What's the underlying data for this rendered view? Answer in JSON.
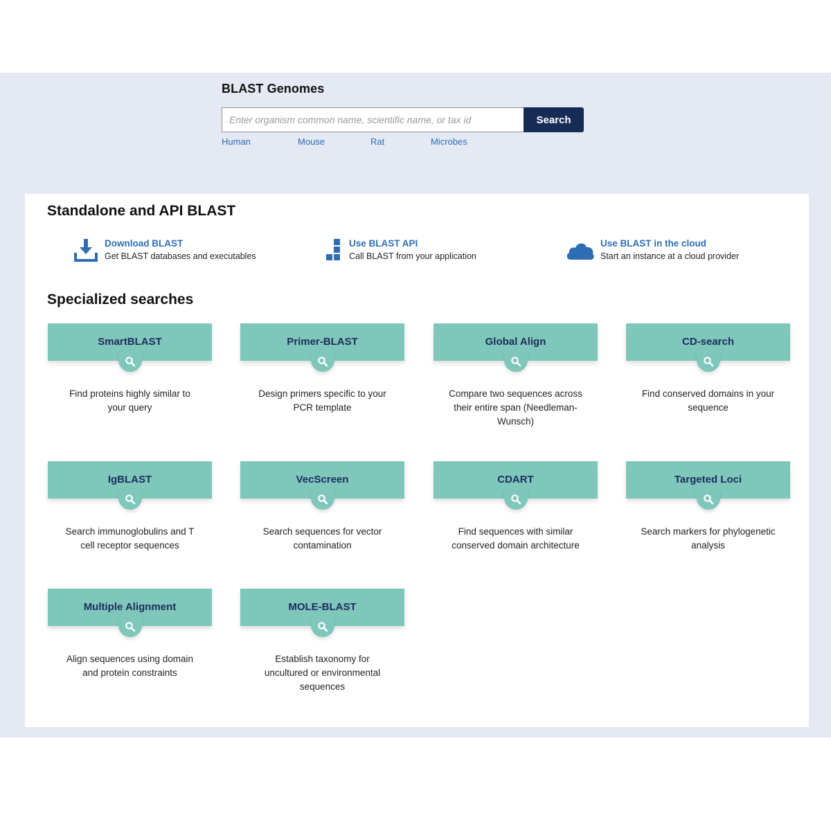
{
  "genomes": {
    "title": "BLAST Genomes",
    "search_placeholder": "Enter organism common name, scientific name, or tax id",
    "search_value": "",
    "search_button": "Search",
    "quick_links": [
      "Human",
      "Mouse",
      "Rat",
      "Microbes"
    ]
  },
  "standalone": {
    "title": "Standalone and API BLAST",
    "items": [
      {
        "icon": "download-icon",
        "title": "Download BLAST",
        "desc": "Get BLAST databases and executables"
      },
      {
        "icon": "api-blocks-icon",
        "title": "Use BLAST API",
        "desc": "Call BLAST from your application"
      },
      {
        "icon": "cloud-icon",
        "title": "Use BLAST in the cloud",
        "desc": "Start an instance at a cloud provider"
      }
    ]
  },
  "specialized": {
    "title": "Specialized searches",
    "cards": [
      {
        "label": "SmartBLAST",
        "desc": "Find proteins highly similar to your query"
      },
      {
        "label": "Primer-BLAST",
        "desc": "Design primers specific to your PCR template"
      },
      {
        "label": "Global Align",
        "desc": "Compare two sequences across their entire span (Needleman-Wunsch)"
      },
      {
        "label": "CD-search",
        "desc": "Find conserved domains in your sequence"
      },
      {
        "label": "IgBLAST",
        "desc": "Search immunoglobulins and T cell receptor sequences"
      },
      {
        "label": "VecScreen",
        "desc": "Search sequences for vector contamination"
      },
      {
        "label": "CDART",
        "desc": "Find sequences with similar conserved domain architecture"
      },
      {
        "label": "Targeted Loci",
        "desc": "Search markers for phylogenetic analysis"
      },
      {
        "label": "Multiple Alignment",
        "desc": "Align sequences using domain and protein constraints"
      },
      {
        "label": "MOLE-BLAST",
        "desc": "Establish taxonomy for uncultured or environmental sequences"
      }
    ]
  },
  "colors": {
    "band_bg": "#e4e9f4",
    "card_teal": "#7fc6bb",
    "card_label": "#1a2f5a",
    "link_blue": "#2e6db4",
    "search_button": "#172b57"
  }
}
